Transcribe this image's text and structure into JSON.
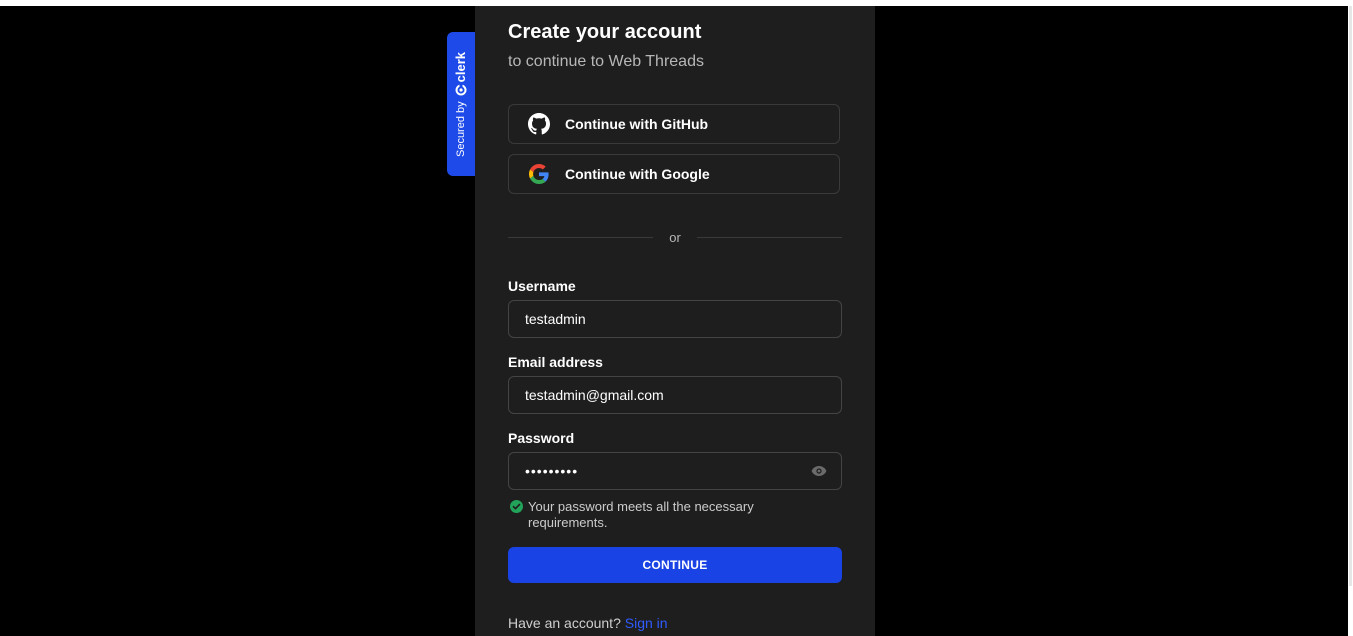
{
  "badge": {
    "secured_by": "Secured by",
    "brand": "clerk"
  },
  "header": {
    "title": "Create your account",
    "subtitle": "to continue to Web Threads"
  },
  "social": {
    "github_label": "Continue with GitHub",
    "google_label": "Continue with Google"
  },
  "divider": {
    "text": "or"
  },
  "form": {
    "username": {
      "label": "Username",
      "value": "testadmin"
    },
    "email": {
      "label": "Email address",
      "value": "testadmin@gmail.com"
    },
    "password": {
      "label": "Password",
      "value": "•••••••••"
    },
    "password_hint": "Your password meets all the necessary requirements.",
    "continue_label": "CONTINUE"
  },
  "footer": {
    "prompt": "Have an account?",
    "link": "Sign in"
  },
  "colors": {
    "accent": "#1a43e6",
    "badge": "#1d4ae8",
    "success": "#22a35a",
    "link": "#2f5bff"
  }
}
